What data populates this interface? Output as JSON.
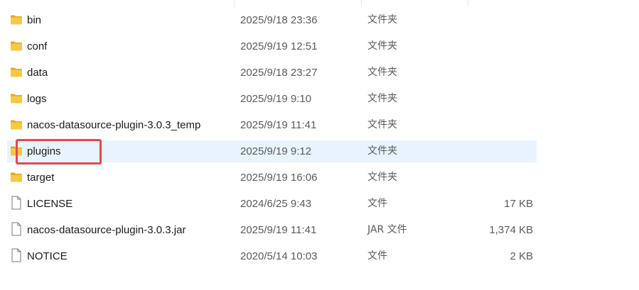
{
  "files": [
    {
      "name": "bin",
      "date": "2025/9/18 23:36",
      "type": "文件夹",
      "size": "",
      "icon": "folder-icon"
    },
    {
      "name": "conf",
      "date": "2025/9/19 12:51",
      "type": "文件夹",
      "size": "",
      "icon": "folder-icon"
    },
    {
      "name": "data",
      "date": "2025/9/18 23:27",
      "type": "文件夹",
      "size": "",
      "icon": "folder-icon"
    },
    {
      "name": "logs",
      "date": "2025/9/19 9:10",
      "type": "文件夹",
      "size": "",
      "icon": "folder-icon"
    },
    {
      "name": "nacos-datasource-plugin-3.0.3_temp",
      "date": "2025/9/19 11:41",
      "type": "文件夹",
      "size": "",
      "icon": "folder-icon"
    },
    {
      "name": "plugins",
      "date": "2025/9/19 9:12",
      "type": "文件夹",
      "size": "",
      "icon": "folder-icon",
      "selected": true
    },
    {
      "name": "target",
      "date": "2025/9/19 16:06",
      "type": "文件夹",
      "size": "",
      "icon": "folder-icon"
    },
    {
      "name": "LICENSE",
      "date": "2024/6/25 9:43",
      "type": "文件",
      "size": "17 KB",
      "icon": "file-icon"
    },
    {
      "name": "nacos-datasource-plugin-3.0.3.jar",
      "date": "2025/9/19 11:41",
      "type": "JAR 文件",
      "size": "1,374 KB",
      "icon": "file-icon"
    },
    {
      "name": "NOTICE",
      "date": "2020/5/14 10:03",
      "type": "文件",
      "size": "2 KB",
      "icon": "file-icon"
    }
  ],
  "colors": {
    "folder": "#f7c843",
    "folder_dark": "#e6a817",
    "selection": "#e8f3fd",
    "highlight_border": "#e5484d"
  }
}
